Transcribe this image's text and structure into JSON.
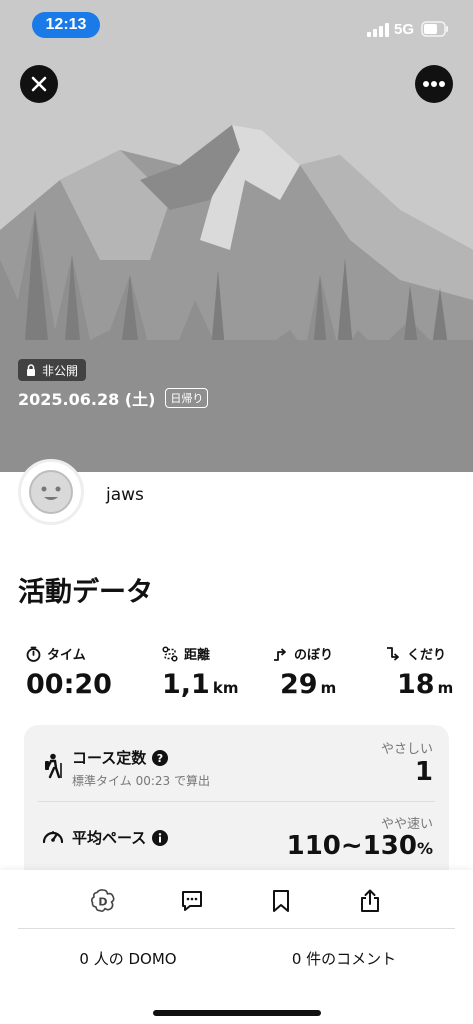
{
  "status": {
    "time": "12:13",
    "network": "5G"
  },
  "hero": {
    "privacy_label": "非公開",
    "date": "2025.06.28 (土)",
    "trip_type": "日帰り"
  },
  "user": {
    "name": "jaws"
  },
  "section": {
    "title": "活動データ"
  },
  "stats": [
    {
      "label": "タイム",
      "icon": "stopwatch-icon",
      "value": "00:20",
      "unit": ""
    },
    {
      "label": "距離",
      "icon": "route-icon",
      "value": "1,1",
      "unit": "km"
    },
    {
      "label": "のぼり",
      "icon": "ascent-icon",
      "value": "29",
      "unit": "m"
    },
    {
      "label": "くだり",
      "icon": "descent-icon",
      "value": "18",
      "unit": "m"
    }
  ],
  "course": {
    "title": "コース定数",
    "subtitle": "標準タイム 00:23 で算出",
    "level_label": "やさしい",
    "value": "1"
  },
  "pace": {
    "title": "平均ペース",
    "level_label": "やや速い",
    "value": "110~130",
    "unit": "%"
  },
  "counts": {
    "domo": "0 人の DOMO",
    "comments": "0 件のコメント"
  }
}
